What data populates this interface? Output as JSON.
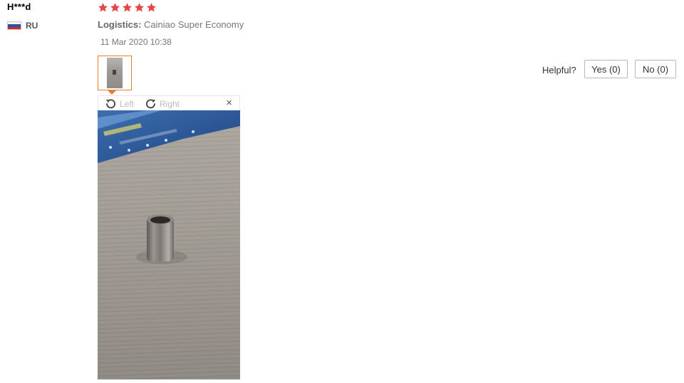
{
  "reviewer": {
    "name": "H***d",
    "country_code": "RU",
    "flag_icon": "russia-flag-icon"
  },
  "review": {
    "rating": 5,
    "max_rating": 5,
    "star_color": "#e64545",
    "logistics_label": "Logistics:",
    "logistics_value": "Cainiao Super Economy",
    "date": "11 Mar 2020 10:38"
  },
  "photo_viewer": {
    "rotate_left_label": "Left",
    "rotate_right_label": "Right",
    "close_label": "×",
    "accent_color": "#e8802b"
  },
  "helpful": {
    "prompt": "Helpful?",
    "yes_label": "Yes (0)",
    "no_label": "No (0)"
  }
}
